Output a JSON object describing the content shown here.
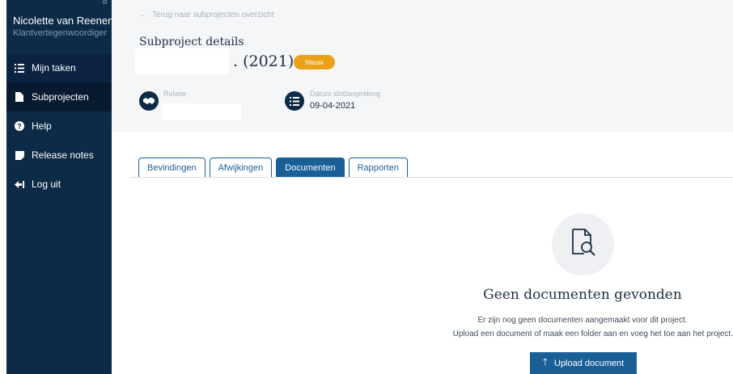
{
  "user": {
    "name": "Nicolette van Reenen",
    "role": "Klantvertegenwoordiger"
  },
  "nav": [
    {
      "label": "Mijn taken",
      "icon": "task-list-icon"
    },
    {
      "label": "Subprojecten",
      "icon": "document-icon"
    },
    {
      "label": "Help",
      "icon": "help-icon"
    },
    {
      "label": "Release notes",
      "icon": "note-icon"
    },
    {
      "label": "Log uit",
      "icon": "logout-icon"
    }
  ],
  "header": {
    "back_link": "Terug naar subprojecten overzicht",
    "title": "Subproject details",
    "project_year": ". (2021)",
    "badge": "Nieuw",
    "relation_label": "Relatie",
    "relation_icon": "handshake-icon",
    "date_label": "Datum slotbespreking",
    "date_value": "09-04-2021",
    "date_icon": "checklist-icon"
  },
  "tabs": [
    {
      "label": "Bevindingen",
      "active": false
    },
    {
      "label": "Afwijkingen",
      "active": false
    },
    {
      "label": "Documenten",
      "active": true
    },
    {
      "label": "Rapporten",
      "active": false
    }
  ],
  "empty_state": {
    "icon": "document-search-icon",
    "title": "Geen documenten gevonden",
    "line1": "Er zijn nog geen documenten aangemaakt voor dit project.",
    "line2": "Upload een document of maak een folder aan en voeg het toe aan het project.",
    "button_label": "Upload document",
    "button_icon": "arrow-up-icon"
  },
  "colors": {
    "sidebar": "#0d2b47",
    "accent": "#1b5f97",
    "badge": "#e9a21a"
  }
}
